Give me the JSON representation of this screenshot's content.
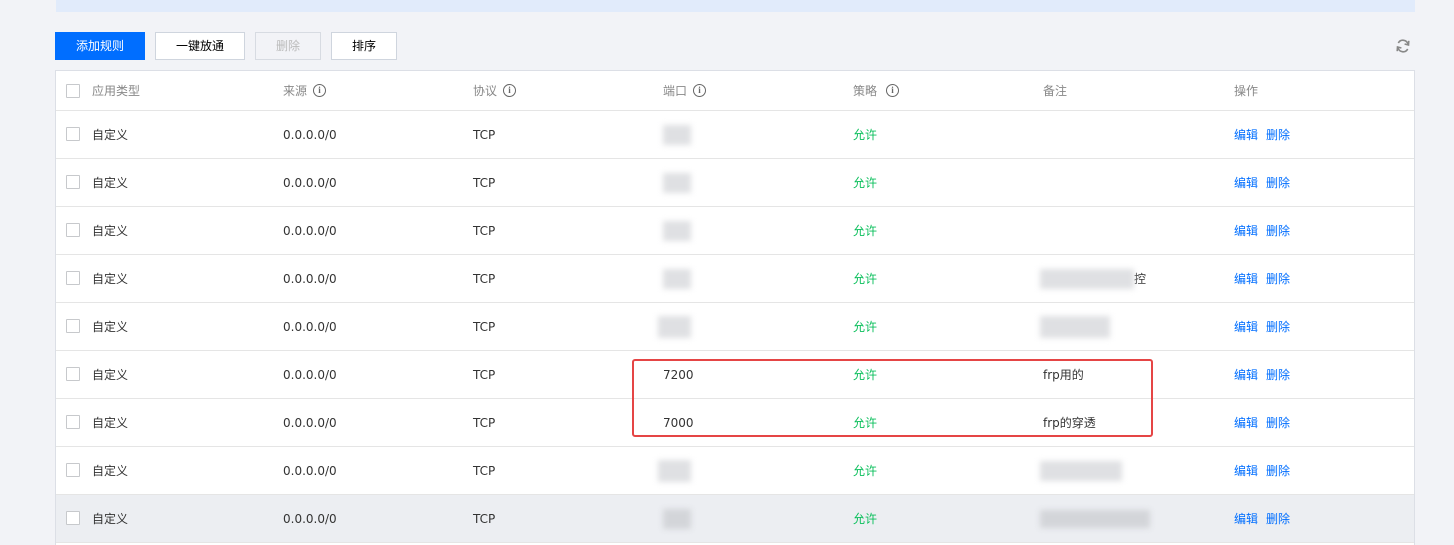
{
  "toolbar": {
    "add_rule": "添加规则",
    "one_click_open": "一键放通",
    "delete": "删除",
    "sort": "排序"
  },
  "icons": {
    "refresh": "refresh-icon",
    "info": "info-circle-icon"
  },
  "colors": {
    "primary": "#006eff",
    "allow": "#0abf5b",
    "highlight_box": "#e54545"
  },
  "table": {
    "headers": {
      "app_type": "应用类型",
      "source": "来源",
      "protocol": "协议",
      "port": "端口",
      "policy": "策略",
      "remark": "备注",
      "actions": "操作"
    },
    "rows": [
      {
        "app_type": "自定义",
        "source": "0.0.0.0/0",
        "protocol": "TCP",
        "port": "",
        "policy": "允许",
        "remark": "",
        "edit": "编辑",
        "delete": "删除"
      },
      {
        "app_type": "自定义",
        "source": "0.0.0.0/0",
        "protocol": "TCP",
        "port": "",
        "policy": "允许",
        "remark": "",
        "edit": "编辑",
        "delete": "删除"
      },
      {
        "app_type": "自定义",
        "source": "0.0.0.0/0",
        "protocol": "TCP",
        "port": "",
        "policy": "允许",
        "remark": "",
        "edit": "编辑",
        "delete": "删除"
      },
      {
        "app_type": "自定义",
        "source": "0.0.0.0/0",
        "protocol": "TCP",
        "port": "",
        "policy": "允许",
        "remark": "控",
        "edit": "编辑",
        "delete": "删除"
      },
      {
        "app_type": "自定义",
        "source": "0.0.0.0/0",
        "protocol": "TCP",
        "port": "",
        "policy": "允许",
        "remark": "",
        "edit": "编辑",
        "delete": "删除"
      },
      {
        "app_type": "自定义",
        "source": "0.0.0.0/0",
        "protocol": "TCP",
        "port": "7200",
        "policy": "允许",
        "remark": "frp用的",
        "edit": "编辑",
        "delete": "删除"
      },
      {
        "app_type": "自定义",
        "source": "0.0.0.0/0",
        "protocol": "TCP",
        "port": "7000",
        "policy": "允许",
        "remark": "frp的穿透",
        "edit": "编辑",
        "delete": "删除"
      },
      {
        "app_type": "自定义",
        "source": "0.0.0.0/0",
        "protocol": "TCP",
        "port": "",
        "policy": "允许",
        "remark": "",
        "edit": "编辑",
        "delete": "删除"
      },
      {
        "app_type": "自定义",
        "source": "0.0.0.0/0",
        "protocol": "TCP",
        "port": "",
        "policy": "允许",
        "remark": "",
        "edit": "编辑",
        "delete": "删除"
      }
    ]
  }
}
